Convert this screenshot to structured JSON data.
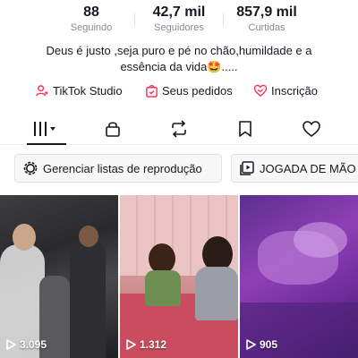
{
  "profile": {
    "stats": [
      {
        "value": "88",
        "label": "Seguindo"
      },
      {
        "value": "42,7 mil",
        "label": "Seguidores"
      },
      {
        "value": "857,9 mil",
        "label": "Curtidas"
      }
    ],
    "bio_line1": "Deus é justo ,seja puro e pé no chão,humildade e a",
    "bio_line2": "essência da vida🤩....."
  },
  "links": {
    "studio": "TikTok Studio",
    "orders": "Seus pedidos",
    "subscription": "Inscrição",
    "accent_color": "#fe2c55"
  },
  "tabs": {
    "icons": [
      "grid-icon",
      "lock-icon",
      "repost-icon",
      "bookmark-icon",
      "heart-icon"
    ],
    "active": 0
  },
  "chips": {
    "playlist": "Gerenciar listas de reprodução",
    "collection": "JOGADA DE MÃO"
  },
  "videos": [
    {
      "views": "3.095"
    },
    {
      "views": "1.312"
    },
    {
      "views": "905"
    }
  ]
}
